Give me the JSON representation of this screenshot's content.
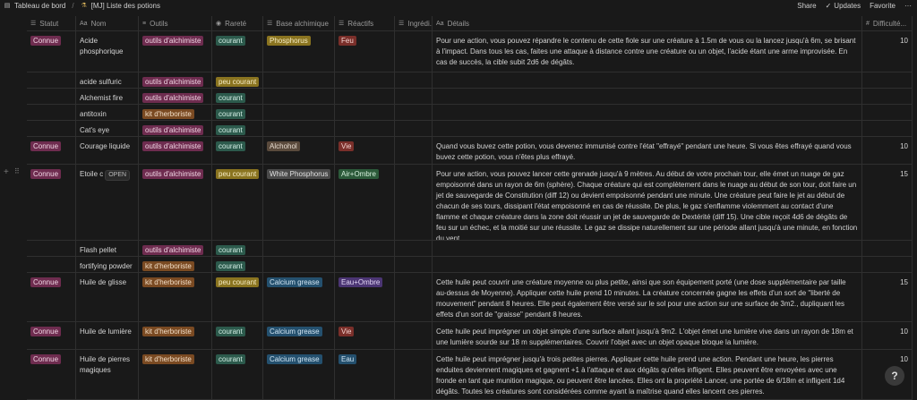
{
  "topbar": {
    "crumb1": "Tableau de bord",
    "crumb_sep": "/",
    "crumb2": "[MJ] Liste des potions",
    "share": "Share",
    "updates": "Updates",
    "favorite": "Favorite",
    "more": "···"
  },
  "columns": [
    {
      "label": "Statut",
      "icon": "list-icon"
    },
    {
      "label": "Nom",
      "icon": "text-icon"
    },
    {
      "label": "Outils",
      "icon": "multi-select-icon"
    },
    {
      "label": "Rareté",
      "icon": "select-icon"
    },
    {
      "label": "Base alchimique",
      "icon": "list-icon"
    },
    {
      "label": "Réactifs",
      "icon": "list-icon"
    },
    {
      "label": "Ingrédi...",
      "icon": "list-icon"
    },
    {
      "label": "Détails",
      "icon": "text-icon"
    },
    {
      "label": "Difficulté...",
      "icon": "number-icon"
    }
  ],
  "open_label": "OPEN",
  "help": "?",
  "rows": [
    {
      "statut": "Connue",
      "nom": "Acide phosphorique",
      "outils": "outils d'alchimiste",
      "outils_kind": "alch",
      "rarete": "courant",
      "rarete_kind": "courant",
      "base": "Phosphorus",
      "base_kind": "yellow",
      "reactifs": "Feu",
      "reactifs_kind": "red",
      "details": "Pour une action, vous pouvez répandre le contenu de cette fiole sur une créature à 1.5m de vous ou la lancez jusqu'à 6m, se brisant à l'impact. Dans tous les cas, faites une attaque à distance contre une créature ou un objet, l'acide étant une arme improvisée. En cas de succès, la cible subit 2d6 de dégâts.",
      "diff": "10"
    },
    {
      "statut": "",
      "nom": "acide sulfuric",
      "outils": "outils d'alchimiste",
      "outils_kind": "alch",
      "rarete": "peu courant",
      "rarete_kind": "peu",
      "base": "",
      "base_kind": "",
      "reactifs": "",
      "reactifs_kind": "",
      "details": "",
      "diff": ""
    },
    {
      "statut": "",
      "nom": "Alchemist fire",
      "outils": "outils d'alchimiste",
      "outils_kind": "alch",
      "rarete": "courant",
      "rarete_kind": "courant",
      "base": "",
      "base_kind": "",
      "reactifs": "",
      "reactifs_kind": "",
      "details": "",
      "diff": ""
    },
    {
      "statut": "",
      "nom": "antitoxin",
      "outils": "kit d'herboriste",
      "outils_kind": "herb",
      "rarete": "courant",
      "rarete_kind": "courant",
      "base": "",
      "base_kind": "",
      "reactifs": "",
      "reactifs_kind": "",
      "details": "",
      "diff": ""
    },
    {
      "statut": "",
      "nom": "Cat's eye",
      "outils": "outils d'alchimiste",
      "outils_kind": "alch",
      "rarete": "courant",
      "rarete_kind": "courant",
      "base": "",
      "base_kind": "",
      "reactifs": "",
      "reactifs_kind": "",
      "details": "",
      "diff": ""
    },
    {
      "statut": "Connue",
      "nom": "Courage liquide",
      "outils": "outils d'alchimiste",
      "outils_kind": "alch",
      "rarete": "courant",
      "rarete_kind": "courant",
      "base": "Alchohol",
      "base_kind": "brown",
      "reactifs": "Vie",
      "reactifs_kind": "red",
      "details": "Quand vous buvez cette potion, vous devenez immunisé contre l'état \"effrayé\" pendant une heure. Si vous êtes effrayé quand vous buvez cette potion, vous n'êtes plus effrayé.",
      "diff": "10"
    },
    {
      "statut": "Connue",
      "nom": "Etoile c",
      "outils": "outils d'alchimiste",
      "outils_kind": "alch",
      "rarete": "peu courant",
      "rarete_kind": "peu",
      "base": "White Phosphorus",
      "base_kind": "gray",
      "reactifs": "Air+Ombre",
      "reactifs_kind": "green",
      "details": "Pour une action, vous pouvez lancer cette grenade jusqu'à 9 mètres. Au début de votre prochain tour, elle émet un nuage de gaz empoisonné dans un rayon de 6m (sphère). Chaque créature qui est complètement dans le nuage au début de son tour, doit faire un jet de sauvegarde de Constitution (diff 12) ou devient empoisonné pendant une minute. Une créature peut faire le jet au début de chacun de ses tours, dissipant l'état empoisonné en cas de réussite. De plus, le gaz s'enflamme violemment au contact d'une flamme et chaque créature dans la zone doit réussir un jet de sauvegarde de Dextérité (diff 15). Une cible reçoit 4d6 de dégâts de feu sur un échec, et la moitié sur une réussite. Le gaz se dissipe naturellement sur une période allant jusqu'à une minute, en fonction du vent.",
      "diff": "15",
      "open": true
    },
    {
      "statut": "",
      "nom": "Flash pellet",
      "outils": "outils d'alchimiste",
      "outils_kind": "alch",
      "rarete": "courant",
      "rarete_kind": "courant",
      "base": "",
      "base_kind": "",
      "reactifs": "",
      "reactifs_kind": "",
      "details": "",
      "diff": ""
    },
    {
      "statut": "",
      "nom": "fortifying powder",
      "outils": "kit d'herboriste",
      "outils_kind": "herb",
      "rarete": "courant",
      "rarete_kind": "courant",
      "base": "",
      "base_kind": "",
      "reactifs": "",
      "reactifs_kind": "",
      "details": "",
      "diff": ""
    },
    {
      "statut": "Connue",
      "nom": "Huile de glisse",
      "outils": "kit d'herboriste",
      "outils_kind": "herb",
      "rarete": "peu courant",
      "rarete_kind": "peu",
      "base": "Calcium grease",
      "base_kind": "blue",
      "reactifs": "Eau+Ombre",
      "reactifs_kind": "purple",
      "details": "Cette huile peut couvrir une créature moyenne ou plus petite, ainsi que son équipement porté (une dose supplémentaire par taille au-dessus de Moyenne). Appliquer cette huile prend 10 minutes. La créature concernée gagne les effets d'un sort de \"liberté de mouvement\" pendant 8 heures. Elle peut également être versé sur le sol pour une action sur une surface de 3m2., dupliquant les effets d'un sort de \"graisse\" pendant 8 heures.",
      "diff": "15"
    },
    {
      "statut": "Connue",
      "nom": "Huile de lumière",
      "outils": "kit d'herboriste",
      "outils_kind": "herb",
      "rarete": "courant",
      "rarete_kind": "courant",
      "base": "Calcium grease",
      "base_kind": "blue",
      "reactifs": "Vie",
      "reactifs_kind": "red",
      "details": "Cette huile peut imprégner un objet simple d'une surface allant jusqu'à 9m2. L'objet émet une lumière vive dans un rayon de 18m et une lumière sourde  sur 18 m supplémentaires. Couvrir l'objet avec un objet opaque bloque la lumière.",
      "diff": "10"
    },
    {
      "statut": "Connue",
      "nom": "Huile de pierres magiques",
      "outils": "kit d'herboriste",
      "outils_kind": "herb",
      "rarete": "courant",
      "rarete_kind": "courant",
      "base": "Calcium grease",
      "base_kind": "blue",
      "reactifs": "Eau",
      "reactifs_kind": "blue",
      "details": "Cette huile peut imprégner jusqu'à trois petites pierres. Appliquer cette huile prend une action. Pendant une heure, les pierres enduites deviennent magiques et gagnent +1 à l'attaque et aux dégâts qu'elles infligent. Elles peuvent être envoyées avec une fronde en tant que munition magique, ou peuvent être lancées. Elles ont la propriété Lancer, une portée de 6/18m et infligent 1d4 dégâts. Toutes les créatures sont considérées comme ayant la maîtrise quand elles lancent ces pierres.",
      "diff": "10"
    }
  ]
}
